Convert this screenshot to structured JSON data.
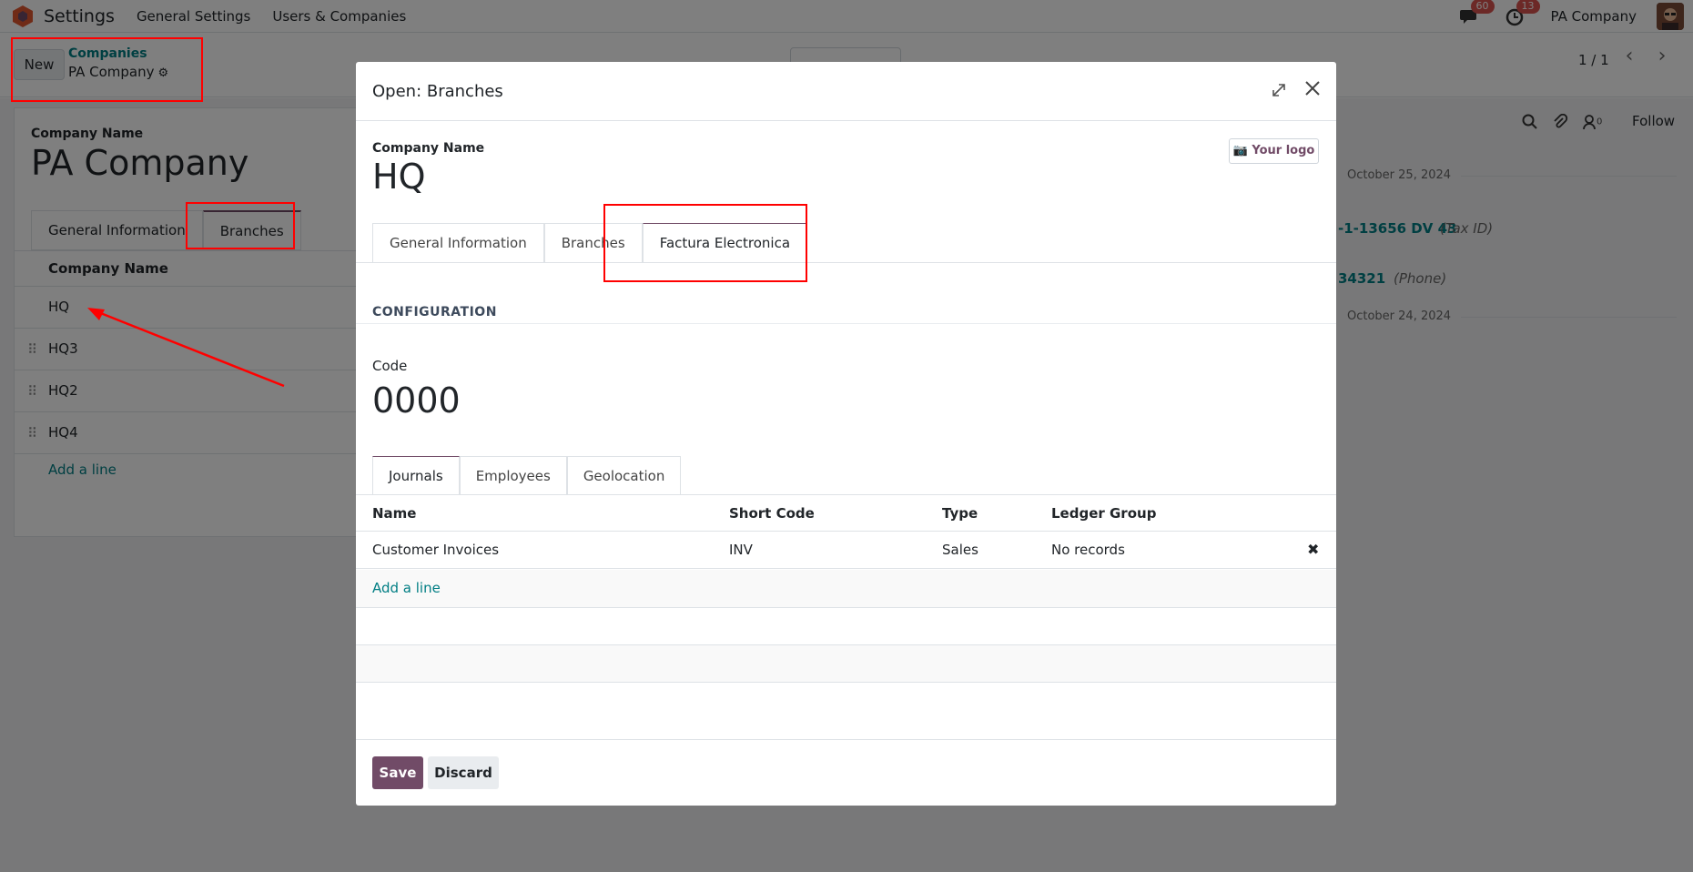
{
  "navbar": {
    "app_title": "Settings",
    "menu": [
      "General Settings",
      "Users & Companies"
    ],
    "messages_count": "60",
    "activities_count": "13",
    "company": "PA Company"
  },
  "control_panel": {
    "new_label": "New",
    "breadcrumb_parent": "Companies",
    "breadcrumb_current": "PA Company",
    "pager": "1 / 1"
  },
  "background_form": {
    "field_label": "Company Name",
    "company_name": "PA Company",
    "tabs": [
      "General Information",
      "Branches"
    ],
    "list_header": "Company Name",
    "rows": [
      "HQ",
      "HQ3",
      "HQ2",
      "HQ4"
    ],
    "add_line": "Add a line"
  },
  "chatter": {
    "follow": "Follow",
    "followers_count": "0",
    "date1": "October 25, 2024",
    "value1": "-1-13656 DV 43",
    "note1": "(Tax ID)",
    "value2": "34321",
    "note2": "(Phone)",
    "date2": "October 24, 2024"
  },
  "modal": {
    "title": "Open: Branches",
    "field_label": "Company Name",
    "company_name": "HQ",
    "logo_label": "Your logo",
    "tabs": [
      "General Information",
      "Branches",
      "Factura Electronica"
    ],
    "section": "CONFIGURATION",
    "code_label": "Code",
    "code_value": "0000",
    "sub_tabs": [
      "Journals",
      "Employees",
      "Geolocation"
    ],
    "table": {
      "columns": [
        "Name",
        "Short Code",
        "Type",
        "Ledger Group"
      ],
      "rows": [
        {
          "name": "Customer Invoices",
          "code": "INV",
          "type": "Sales",
          "ledger": "No records"
        }
      ],
      "add_line": "Add a line"
    },
    "save_label": "Save",
    "discard_label": "Discard"
  },
  "colors": {
    "accent": "#714b67",
    "link": "#017e84",
    "annotation": "#ff0000"
  }
}
